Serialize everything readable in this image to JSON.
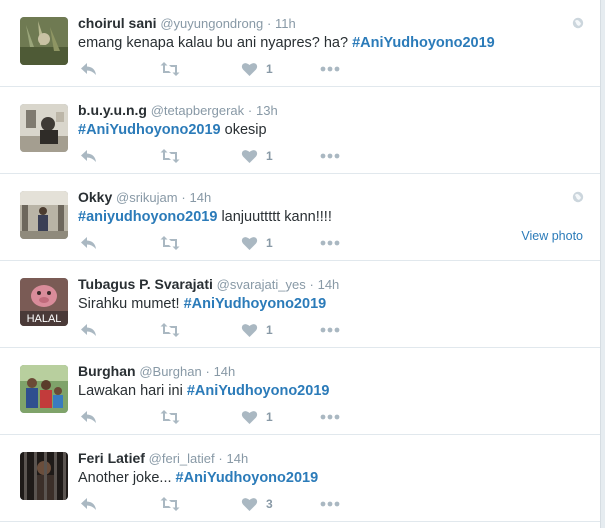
{
  "tweets": [
    {
      "fullname": "choirul sani",
      "username": "@yuyungondrong",
      "time": "11h",
      "text": "emang kenapa kalau bu ani nyapres? ha?",
      "hashtag": "#AniYudhoyono2019",
      "likes": "1",
      "view_photo": ""
    },
    {
      "fullname": "b.u.y.u.n.g",
      "username": "@tetapbergerak",
      "time": "13h",
      "text": "okesip",
      "hashtag": "#AniYudhoyono2019",
      "likes": "1",
      "view_photo": ""
    },
    {
      "fullname": "Okky",
      "username": "@srikujam",
      "time": "14h",
      "text": "lanjuuttttt kann!!!!",
      "hashtag": "#aniyudhoyono2019",
      "likes": "1",
      "view_photo": "View photo"
    },
    {
      "fullname": "Tubagus P. Svarajati",
      "username": "@svarajati_yes",
      "time": "14h",
      "text": "Sirahku mumet!",
      "hashtag": "#AniYudhoyono2019",
      "likes": "1",
      "view_photo": ""
    },
    {
      "fullname": "Burghan",
      "username": "@Burghan",
      "time": "14h",
      "text": "Lawakan hari ini",
      "hashtag": "#AniYudhoyono2019",
      "likes": "1",
      "view_photo": ""
    },
    {
      "fullname": "Feri Latief",
      "username": "@feri_latief",
      "time": "14h",
      "text": "Another joke...",
      "hashtag": "#AniYudhoyono2019",
      "likes": "3",
      "view_photo": ""
    }
  ],
  "avatar_badge_text": "HALAL",
  "icons": {
    "reply": "reply-icon",
    "retweet": "retweet-icon",
    "like": "heart-icon",
    "more": "more-icon",
    "geo": "globe-icon"
  },
  "colors": {
    "link": "#2b7bb9",
    "muted": "#8899a6",
    "action": "#aab8c2",
    "divider": "#e1e8ed"
  }
}
